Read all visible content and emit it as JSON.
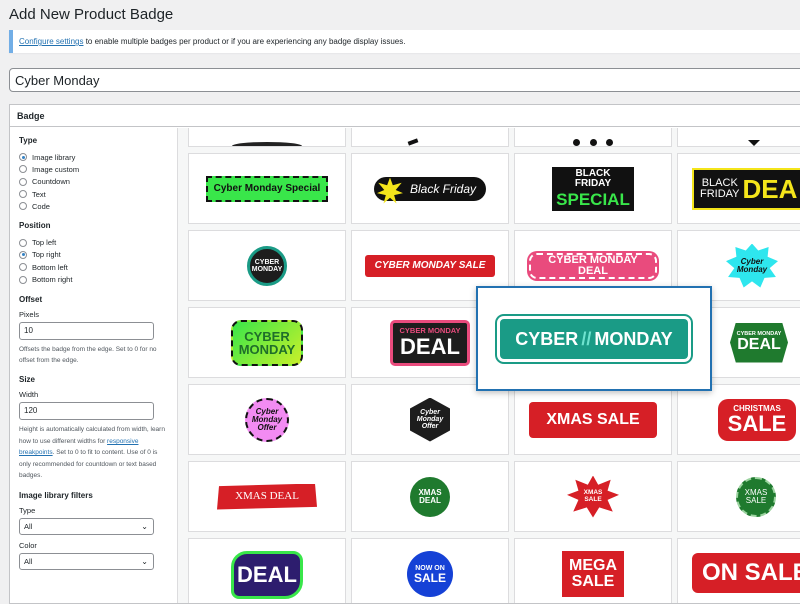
{
  "page": {
    "title": "Add New Product Badge"
  },
  "notice": {
    "link": "Configure settings",
    "text": " to enable multiple badges per product or if you are experiencing any badge display issues."
  },
  "post_title": {
    "value": "Cyber Monday"
  },
  "badge_box": {
    "title": "Badge"
  },
  "sidebar": {
    "type": {
      "title": "Type",
      "options": [
        "Image library",
        "Image custom",
        "Countdown",
        "Text",
        "Code"
      ],
      "selected": "Image library"
    },
    "position": {
      "title": "Position",
      "options": [
        "Top left",
        "Top right",
        "Bottom left",
        "Bottom right"
      ],
      "selected": "Top right"
    },
    "offset": {
      "title": "Offset",
      "label": "Pixels",
      "value": "10",
      "help": "Offsets the badge from the edge. Set to 0 for no offset from the edge."
    },
    "size": {
      "title": "Size",
      "label": "Width",
      "value": "120",
      "help_1": "Height is automatically calculated from width, learn how to use different widths for ",
      "help_link": "responsive breakpoints",
      "help_2": ". Set to 0 to fit to content. Use of 0 is only recommended for countdown or text based badges."
    },
    "filters": {
      "title": "Image library filters",
      "type_label": "Type",
      "type_value": "All",
      "color_label": "Color",
      "color_value": "All"
    }
  },
  "badges": {
    "r1c1": "Cyber Monday Special",
    "r1c2": "Black Friday",
    "r1c3_1": "BLACK FRIDAY",
    "r1c3_2": "SPECIAL",
    "r1c4_1": "BLACK",
    "r1c4_2": "FRIDAY",
    "r1c4_3": "DEA",
    "r2c1_1": "CYBER",
    "r2c1_2": "MONDAY",
    "r2c2": "CYBER MONDAY SALE",
    "r2c3": "CYBER MONDAY DEAL",
    "r2c4_1": "Cyber",
    "r2c4_2": "Monday",
    "r3c1_1": "CYBER",
    "r3c1_2": "MONDAY",
    "r3c2_1": "CYBER MONDAY",
    "r3c2_2": "DEAL",
    "r3c4_1": "CYBER MONDAY",
    "r3c4_2": "DEAL",
    "r4c1_1": "Cyber",
    "r4c1_2": "Monday",
    "r4c1_3": "Offer",
    "r4c2_1": "Cyber",
    "r4c2_2": "Monday",
    "r4c2_3": "Offer",
    "r4c3": "XMAS SALE",
    "r4c4_1": "CHRISTMAS",
    "r4c4_2": "SALE",
    "r5c1": "XMAS DEAL",
    "r5c2_1": "XMAS",
    "r5c2_2": "DEAL",
    "r5c3_1": "XMAS",
    "r5c3_2": "SALE",
    "r5c4_1": "XMAS",
    "r5c4_2": "SALE",
    "r6c1": "DEAL",
    "r6c2_1": "NOW ON",
    "r6c2_2": "SALE",
    "r6c3_1": "MEGA",
    "r6c3_2": "SALE",
    "r6c4": "ON SALE",
    "selected_1": "CYBER",
    "selected_sep": "//",
    "selected_2": "MONDAY"
  },
  "colors": {
    "accent": "#2271b1",
    "teal": "#1a9b86",
    "red": "#d61f26",
    "green": "#1f7a2e",
    "lime": "#39e64a"
  }
}
